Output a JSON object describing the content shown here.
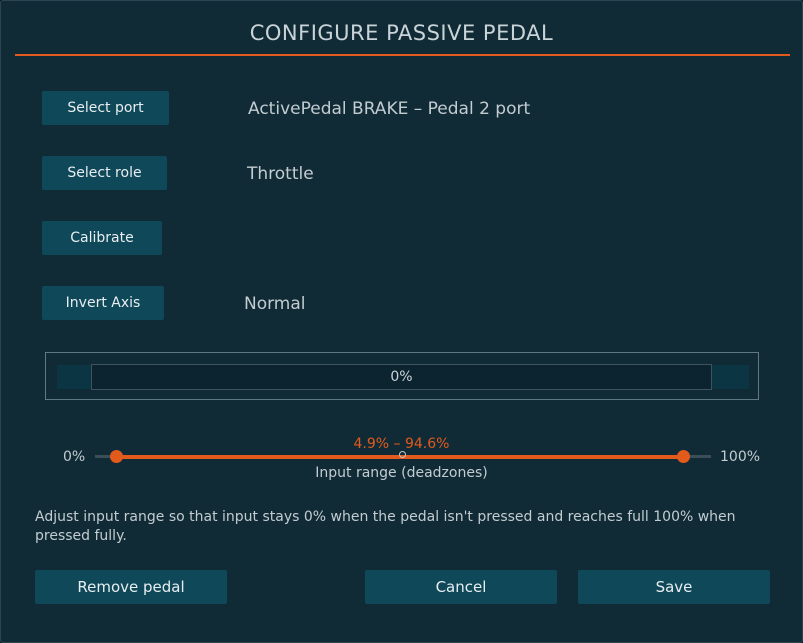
{
  "dialog": {
    "title": "CONFIGURE PASSIVE PEDAL"
  },
  "rows": {
    "port": {
      "button_label": "Select port",
      "value": "ActivePedal BRAKE – Pedal 2 port"
    },
    "role": {
      "button_label": "Select role",
      "value": "Throttle"
    },
    "calibrate": {
      "button_label": "Calibrate"
    },
    "invert": {
      "button_label": "Invert Axis",
      "value": "Normal"
    }
  },
  "input_meter": {
    "value_label": "0%",
    "value_fraction": 0.0
  },
  "input_range": {
    "min_label": "0%",
    "max_label": "100%",
    "range_label": "4.9% – 94.6%",
    "caption": "Input range (deadzones)",
    "low_percent": 4.9,
    "high_percent": 94.6
  },
  "help_text": "Adjust input range so that input stays 0% when the pedal isn't pressed and reaches full 100% when pressed fully.",
  "footer": {
    "remove_label": "Remove pedal",
    "cancel_label": "Cancel",
    "save_label": "Save"
  },
  "colors": {
    "accent": "#e25a1c",
    "button_bg": "#0f4858",
    "dialog_bg": "#112b36"
  }
}
